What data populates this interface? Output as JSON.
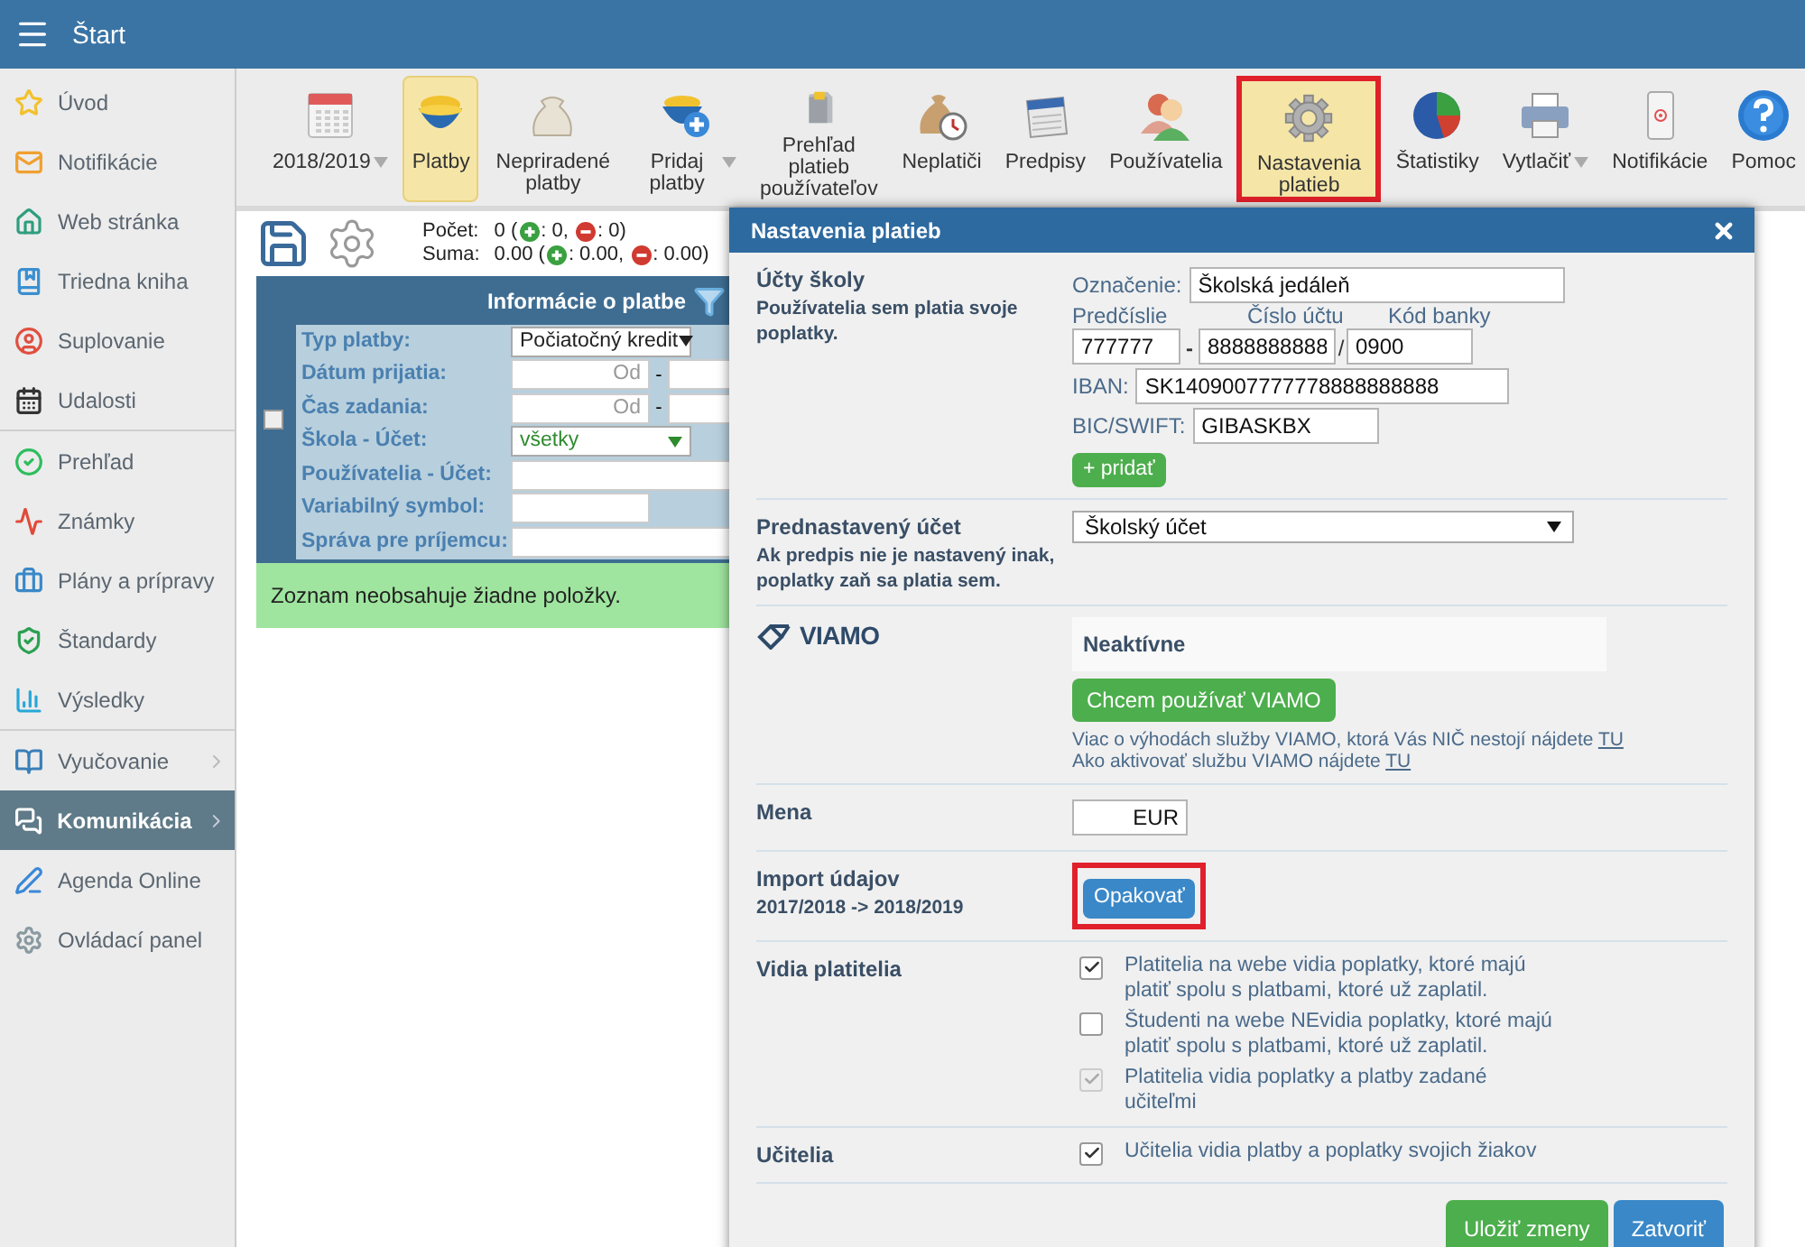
{
  "header": {
    "title": "Štart"
  },
  "sidebar": {
    "groups": [
      {
        "items": [
          {
            "label": "Úvod",
            "selected": false,
            "submenu": false
          },
          {
            "label": "Notifikácie",
            "selected": false,
            "submenu": false
          },
          {
            "label": "Web stránka",
            "selected": false,
            "submenu": false
          },
          {
            "label": "Triedna kniha",
            "selected": false,
            "submenu": false
          },
          {
            "label": "Suplovanie",
            "selected": false,
            "submenu": false
          },
          {
            "label": "Udalosti",
            "selected": false,
            "submenu": false
          }
        ]
      },
      {
        "items": [
          {
            "label": "Prehľad",
            "selected": false,
            "submenu": false
          },
          {
            "label": "Známky",
            "selected": false,
            "submenu": false
          },
          {
            "label": "Plány a prípravy",
            "selected": false,
            "submenu": false
          },
          {
            "label": "Štandardy",
            "selected": false,
            "submenu": false
          },
          {
            "label": "Výsledky",
            "selected": false,
            "submenu": false
          }
        ]
      },
      {
        "items": [
          {
            "label": "Vyučovanie",
            "selected": false,
            "submenu": true
          },
          {
            "label": "Komunikácia",
            "selected": true,
            "submenu": true
          },
          {
            "label": "Agenda Online",
            "selected": false,
            "submenu": false
          },
          {
            "label": "Ovládací panel",
            "selected": false,
            "submenu": false
          }
        ]
      }
    ]
  },
  "toolbar": {
    "items": [
      {
        "label": "2018/2019",
        "selected": false,
        "highlighted": false,
        "dropdown": true
      },
      {
        "label": "Platby",
        "selected": true,
        "highlighted": false,
        "dropdown": false
      },
      {
        "label": "Nepriradené platby",
        "selected": false,
        "highlighted": false,
        "dropdown": false
      },
      {
        "label": "Pridaj platby",
        "selected": false,
        "highlighted": false,
        "dropdown": true
      },
      {
        "label": "Prehľad platieb používateľov",
        "selected": false,
        "highlighted": false,
        "dropdown": false
      },
      {
        "label": "Neplatiči",
        "selected": false,
        "highlighted": false,
        "dropdown": false
      },
      {
        "label": "Predpisy",
        "selected": false,
        "highlighted": false,
        "dropdown": false
      },
      {
        "label": "Používatelia",
        "selected": false,
        "highlighted": false,
        "dropdown": false
      },
      {
        "label": "Nastavenia platieb",
        "selected": true,
        "highlighted": true,
        "dropdown": false
      },
      {
        "label": "Štatistiky",
        "selected": false,
        "highlighted": false,
        "dropdown": false
      },
      {
        "label": "Vytlačiť",
        "selected": false,
        "highlighted": false,
        "dropdown": true
      },
      {
        "label": "Notifikácie",
        "selected": false,
        "highlighted": false,
        "dropdown": false
      },
      {
        "label": "Pomoc",
        "selected": false,
        "highlighted": false,
        "dropdown": false
      }
    ]
  },
  "payments_panel": {
    "counts": [
      {
        "label": "Počet:",
        "total": "0 (",
        "plus": ": 0,",
        "minus": ": 0)"
      },
      {
        "label": "Suma:",
        "total": "0.00 (",
        "plus": ": 0.00,",
        "minus": ": 0.00)"
      }
    ],
    "filter": {
      "title": "Informácie o platbe",
      "select_all_checked": false,
      "rows": [
        {
          "label": "Typ platby:",
          "kind": "select",
          "value": "Počiatočný kredit",
          "color": "#222222"
        },
        {
          "label": "Dátum prijatia:",
          "kind": "range",
          "placeholder": "Od",
          "separator": "-"
        },
        {
          "label": "Čas zadania:",
          "kind": "range",
          "placeholder": "Od",
          "separator": "-"
        },
        {
          "label": "Škola - Účet:",
          "kind": "select",
          "value": "všetky",
          "color": "#2e8b2e"
        },
        {
          "label": "Používatelia - Účet:",
          "kind": "input"
        },
        {
          "label": "Variabilný symbol:",
          "kind": "short_input"
        },
        {
          "label": "Správa pre príjemcu:",
          "kind": "input"
        }
      ]
    },
    "empty_message": "Zoznam neobsahuje žiadne položky."
  },
  "dialog": {
    "title": "Nastavenia platieb",
    "sections": [
      {
        "kind": "accounts",
        "title": "Účty školy",
        "subtitle": "Používatelia sem platia svoje poplatky.",
        "designation_label": "Označenie:",
        "designation": "Školská jedáleň",
        "column_labels": [
          "Predčíslie",
          "Číslo účtu",
          "Kód banky"
        ],
        "prefix": "777777",
        "dash": "-",
        "number": "8888888888",
        "slash": "/",
        "bank_code": "0900",
        "iban_label": "IBAN:",
        "iban": "SK1409007777778888888888",
        "bic_label": "BIC/SWIFT:",
        "bic": "GIBASKBX",
        "add_button": "+ pridať"
      },
      {
        "kind": "default_account",
        "title": "Prednastavený účet",
        "subtitle": "Ak predpis nie je nastavený inak, poplatky zaň sa platia sem.",
        "value": "Školský účet"
      },
      {
        "kind": "viamo",
        "logo": "VIAMO",
        "status": "Neaktívne",
        "button": "Chcem používať VIAMO",
        "lines": [
          {
            "text": "Viac o výhodách služby VIAMO, ktorá Vás NIČ nestojí nájdete ",
            "link": "TU"
          },
          {
            "text": "Ako aktivovať službu VIAMO nájdete ",
            "link": "TU"
          }
        ]
      },
      {
        "kind": "currency",
        "title": "Mena",
        "value": "EUR"
      },
      {
        "kind": "import",
        "title": "Import údajov",
        "subtitle": "2017/2018 -> 2018/2019",
        "button": "Opakovať",
        "highlighted": true
      },
      {
        "kind": "checkboxes",
        "title": "Vidia platitelia",
        "options": [
          {
            "label": "Platitelia na webe vidia poplatky, ktoré majú platiť spolu s platbami, ktoré už zaplatil.",
            "checked": true,
            "disabled": false
          },
          {
            "label": "Študenti na webe NEvidia poplatky, ktoré majú platiť spolu s platbami, ktoré už zaplatil.",
            "checked": false,
            "disabled": false
          },
          {
            "label": "Platitelia vidia poplatky a platby zadané učiteľmi",
            "checked": true,
            "disabled": true
          }
        ]
      },
      {
        "kind": "checkboxes",
        "title": "Učitelia",
        "options": [
          {
            "label": "Učitelia vidia platby a poplatky svojich žiakov",
            "checked": true,
            "disabled": false
          }
        ]
      }
    ],
    "buttons": [
      {
        "label": "Uložiť zmeny",
        "kind": "save"
      },
      {
        "label": "Zatvoriť",
        "kind": "close"
      }
    ]
  }
}
